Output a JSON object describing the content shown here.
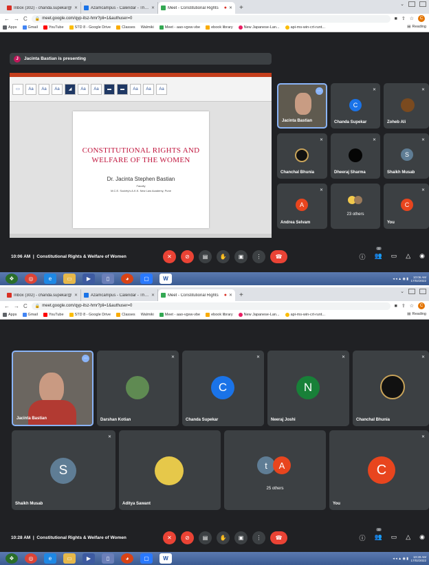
{
  "tabs": [
    {
      "label": "Inbox (302) - chanda.supekar@",
      "color": "#d93025"
    },
    {
      "label": "Azamcampus - Calendar - Thurs",
      "color": "#1a73e8"
    },
    {
      "label": "Meet - Constitutional Rights",
      "color": "#34a853"
    }
  ],
  "new_tab": "+",
  "url1": "meet.google.com/qyp-itsz-hmr?pli=1&authuser=0",
  "url2": "meet.google.com/qyp-itsz-hmr?pli=1&authuser=0",
  "profile_initial": "C",
  "bookmarks": [
    {
      "label": "Apps",
      "color": "#5f6368"
    },
    {
      "label": "Gmail",
      "color": "#4285f4"
    },
    {
      "label": "YouTube",
      "color": "#ff0000"
    },
    {
      "label": "STD 8 - Google Drive",
      "color": "#fbbc04"
    },
    {
      "label": "Classes",
      "color": "#f9ab00"
    },
    {
      "label": "Walmiki",
      "color": "#ffffff"
    },
    {
      "label": "Meet - aao-vgvw-vbe",
      "color": "#34a853"
    },
    {
      "label": "ebook library",
      "color": "#f9ab00"
    },
    {
      "label": "New Japanese-Lan...",
      "color": "#e91e63"
    },
    {
      "label": "api-ms-win-crt-runt...",
      "color": "#fbbc04"
    }
  ],
  "reading_list": "Reading",
  "presenting": {
    "initial": "J",
    "text": "Jacinta Bastian is presenting"
  },
  "slide": {
    "title_line1": "CONSTITUTIONAL RIGHTS AND",
    "title_line2": "WELFARE OF THE WOMEN",
    "author": "Dr. Jacinta Stephen Bastian",
    "role": "Faculty",
    "institution": "M.C.E. Society's A.K.K. New Law Academy, Pune"
  },
  "grid1": [
    {
      "name": "Jacinta Bastian",
      "kind": "photo"
    },
    {
      "name": "Chanda Supekar",
      "initial": "C",
      "color": "#1a73e8"
    },
    {
      "name": "Zoheb Ali",
      "kind": "photo"
    },
    {
      "name": "Chanchal Bhunia",
      "kind": "photo"
    },
    {
      "name": "Dheeraj Sharma",
      "kind": "photo"
    },
    {
      "name": "Shaikh Musab",
      "initial": "S",
      "color": "#5f7d95"
    },
    {
      "name": "Andrea Selvam",
      "initial": "A",
      "color": "#e8451e"
    },
    {
      "name": "23 others",
      "kind": "group"
    },
    {
      "name": "You",
      "initial": "C",
      "color": "#e8451e"
    }
  ],
  "grid2": [
    {
      "name": "Jacinta Bastian",
      "kind": "photo"
    },
    {
      "name": "Darshan Kotian",
      "kind": "photo"
    },
    {
      "name": "Chanda Supekar",
      "initial": "C",
      "color": "#1a73e8"
    },
    {
      "name": "Neeraj Joshi",
      "initial": "N",
      "color": "#188038"
    },
    {
      "name": "Chanchal Bhunia",
      "kind": "photo"
    },
    {
      "name": "Shaikh Musab",
      "initial": "S",
      "color": "#5f7d95"
    },
    {
      "name": "Aditya Sawant",
      "kind": "photo"
    },
    {
      "name": "25 others",
      "initials": [
        "t",
        "A"
      ]
    },
    {
      "name": "You",
      "initial": "C",
      "color": "#e8451e"
    }
  ],
  "bar1": {
    "time": "10:06 AM",
    "meeting": "Constitutional Rights & Welfare of Women",
    "count": "32"
  },
  "bar2": {
    "time": "10:28 AM",
    "meeting": "Constitutional Rights & Welfare of Women",
    "count": "33"
  },
  "clock1": {
    "time": "10:06 AM",
    "date": "17/02/2022"
  },
  "clock2": {
    "time": "10:28 AM",
    "date": "17/02/2022"
  }
}
